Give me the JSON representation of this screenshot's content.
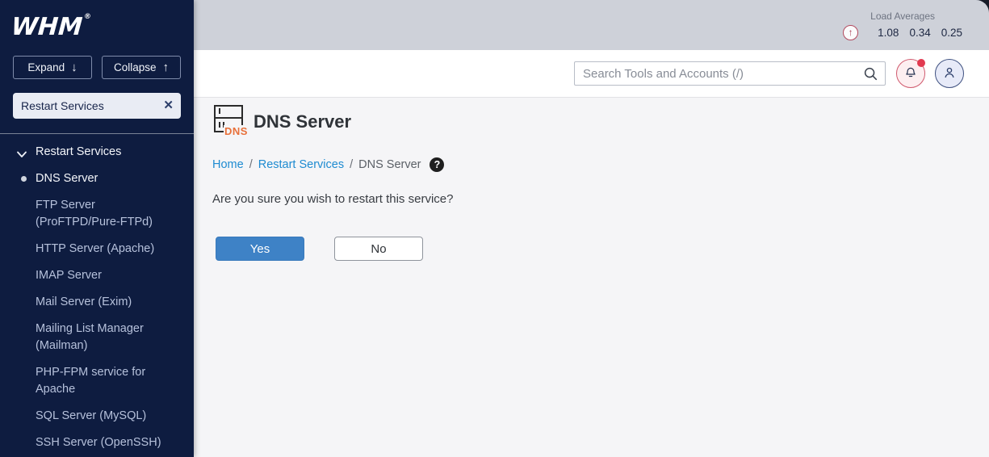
{
  "sidebar": {
    "logo_text": "WHM",
    "logo_reg": "®",
    "expand_label": "Expand",
    "collapse_label": "Collapse",
    "filter_value": "Restart Services",
    "nav_group_label": "Restart Services",
    "nav_active_item": "DNS Server",
    "nav_items": [
      "FTP Server (ProFTPD/Pure-FTPd)",
      "HTTP Server (Apache)",
      "IMAP Server",
      "Mail Server (Exim)",
      "Mailing List Manager (Mailman)",
      "PHP-FPM service for Apache",
      "SQL Server (MySQL)",
      "SSH Server (OpenSSH)"
    ]
  },
  "topbar": {
    "load_averages_label": "Load Averages",
    "load_values": [
      "1.08",
      "0.34",
      "0.25"
    ]
  },
  "header": {
    "search_placeholder": "Search Tools and Accounts (/)"
  },
  "content": {
    "page_title": "DNS Server",
    "page_icon_label": "DNS",
    "breadcrumb": {
      "home": "Home",
      "section": "Restart Services",
      "current": "DNS Server",
      "separator": "/"
    },
    "question": "Are you sure you wish to restart this service?",
    "yes_label": "Yes",
    "no_label": "No"
  },
  "icons": {
    "arrow_down": "↓",
    "arrow_up": "↑",
    "close": "✕",
    "help": "?",
    "load_arrow": "↑"
  },
  "colors": {
    "sidebar_bg": "#0e1c40",
    "topbar_bg": "#ced1d9",
    "content_bg": "#f5f5f7",
    "accent_blue": "#3e82c6",
    "link_blue": "#1e8bd1",
    "alert_red": "#e23a50",
    "dns_orange": "#e8703a"
  }
}
